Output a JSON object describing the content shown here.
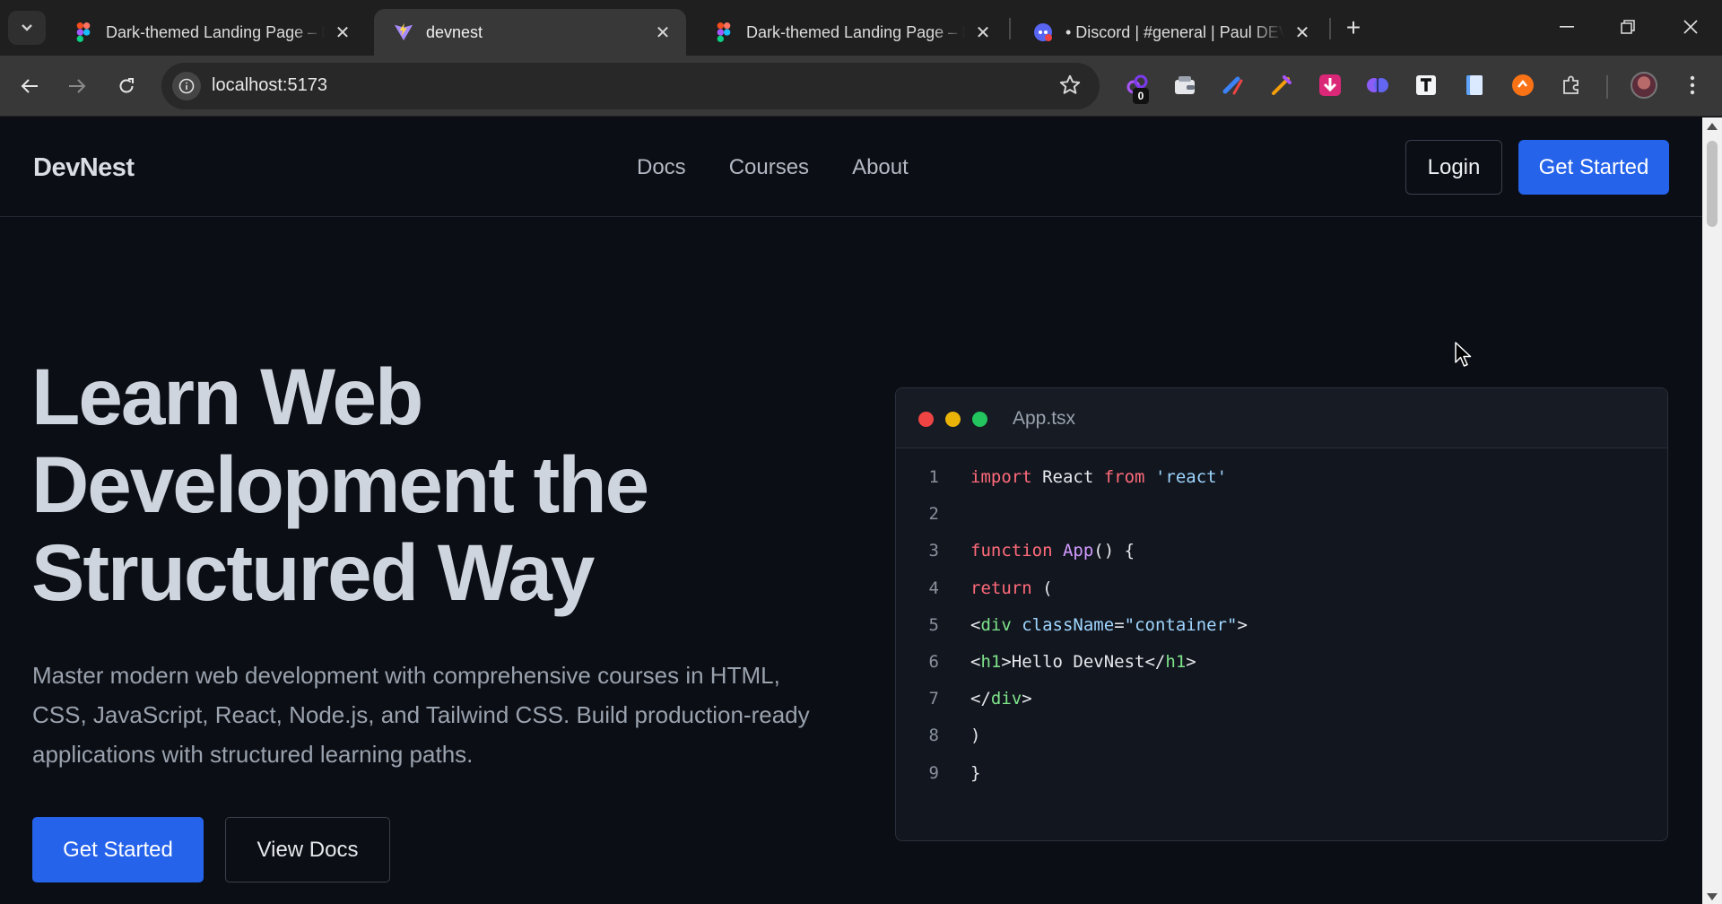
{
  "browser": {
    "tabs": [
      {
        "title": "Dark-themed Landing Page – Figma",
        "favicon": "figma-icon",
        "active": false
      },
      {
        "title": "devnest",
        "favicon": "vite-icon",
        "active": true
      },
      {
        "title": "Dark-themed Landing Page – Figma",
        "favicon": "figma-icon",
        "active": false
      },
      {
        "title": "• Discord | #general | Paul DEV's",
        "favicon": "discord-icon",
        "active": false
      }
    ],
    "url": "localhost:5173",
    "extension_badge": "0"
  },
  "site": {
    "logo": "DevNest",
    "nav": [
      "Docs",
      "Courses",
      "About"
    ],
    "login_label": "Login",
    "get_started_label": "Get Started"
  },
  "hero": {
    "title_line1": "Learn Web",
    "title_line2": "Development the",
    "title_line3": "Structured Way",
    "subtitle": "Master modern web development with comprehensive courses in HTML, CSS, JavaScript, React, Node.js, and Tailwind CSS. Build production-ready applications with structured learning paths.",
    "primary_label": "Get Started",
    "secondary_label": "View Docs"
  },
  "code_window": {
    "filename": "App.tsx",
    "dot_colors": [
      "#ef4444",
      "#eab308",
      "#22c55e"
    ],
    "lines": [
      {
        "n": "1",
        "tokens": [
          [
            "kw",
            "import"
          ],
          [
            "punc",
            " React "
          ],
          [
            "kw",
            "from"
          ],
          [
            "punc",
            " "
          ],
          [
            "str",
            "'react'"
          ]
        ]
      },
      {
        "n": "2",
        "tokens": []
      },
      {
        "n": "3",
        "tokens": [
          [
            "kw",
            "function"
          ],
          [
            "punc",
            " "
          ],
          [
            "fn",
            "App"
          ],
          [
            "punc",
            "() {"
          ]
        ]
      },
      {
        "n": "4",
        "tokens": [
          [
            "kw",
            "return"
          ],
          [
            "punc",
            " ("
          ]
        ]
      },
      {
        "n": "5",
        "tokens": [
          [
            "punc",
            "<"
          ],
          [
            "tag",
            "div"
          ],
          [
            "punc",
            " "
          ],
          [
            "attr",
            "className"
          ],
          [
            "punc",
            "="
          ],
          [
            "str",
            "\"container\""
          ],
          [
            "punc",
            ">"
          ]
        ]
      },
      {
        "n": "6",
        "tokens": [
          [
            "punc",
            "<"
          ],
          [
            "tag",
            "h1"
          ],
          [
            "punc",
            ">Hello DevNest</"
          ],
          [
            "tag",
            "h1"
          ],
          [
            "punc",
            ">"
          ]
        ]
      },
      {
        "n": "7",
        "tokens": [
          [
            "punc",
            "</"
          ],
          [
            "tag",
            "div"
          ],
          [
            "punc",
            ">"
          ]
        ]
      },
      {
        "n": "8",
        "tokens": [
          [
            "punc",
            ")"
          ]
        ]
      },
      {
        "n": "9",
        "tokens": [
          [
            "punc",
            "}"
          ]
        ]
      }
    ]
  },
  "colors": {
    "accent": "#2563eb",
    "page_bg": "#0b0e14"
  }
}
